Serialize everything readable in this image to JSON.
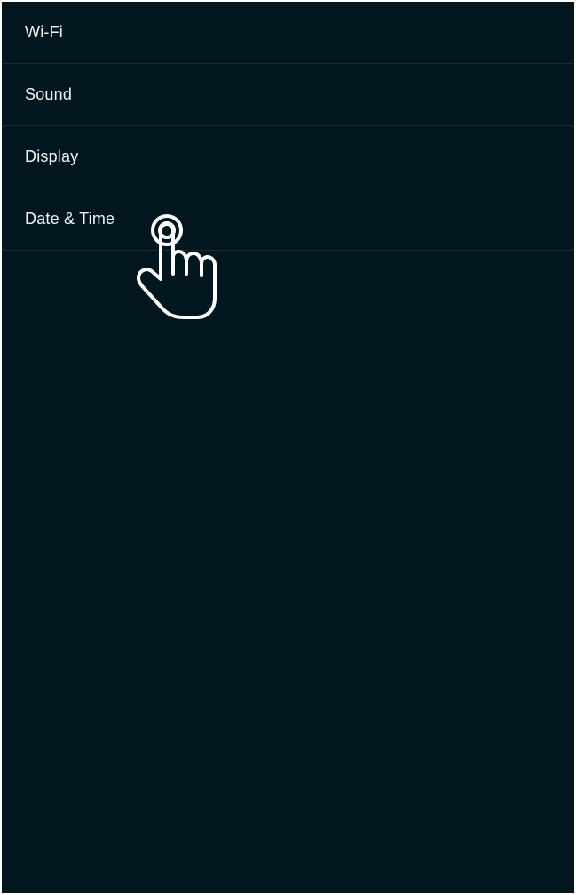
{
  "settings": {
    "items": [
      {
        "label": "Wi-Fi"
      },
      {
        "label": "Sound"
      },
      {
        "label": "Display"
      },
      {
        "label": "Date & Time"
      }
    ]
  },
  "overlay": {
    "icon": "tap-hand-icon"
  },
  "colors": {
    "background": "#01161e",
    "divider": "#1b2b31",
    "text": "#f2f5f6",
    "hand_stroke": "#ffffff"
  }
}
